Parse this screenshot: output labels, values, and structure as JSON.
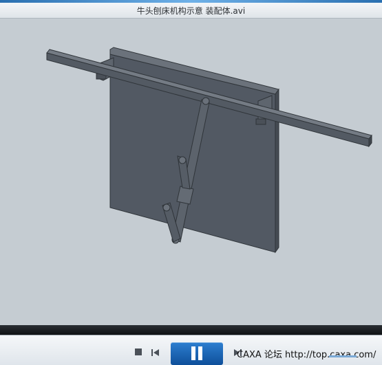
{
  "window": {
    "title": "牛头刨床机构示意 装配体.avi"
  },
  "player": {
    "controls": {
      "stop": "stop-icon",
      "previous": "skip-previous-icon",
      "play_pause": "pause-icon",
      "next": "skip-next-icon"
    },
    "overlay_text": "CAXA 论坛 http://top.caxa.com/"
  },
  "colors": {
    "viewport_bg": "#c5ccd2",
    "part_fill": "#515861",
    "part_edge": "#2f3439",
    "accent_button": "#1460b0"
  }
}
